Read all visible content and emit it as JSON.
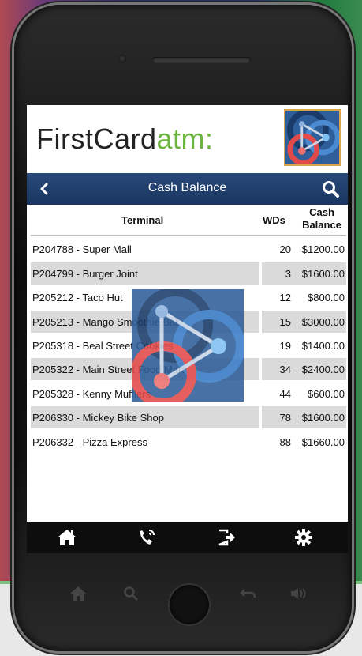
{
  "app": {
    "brand_main": "FirstCard",
    "brand_accent": "atm:",
    "accent_color": "#6db33f",
    "nav_color": "#1f3e6c"
  },
  "navbar": {
    "title": "Cash Balance",
    "back_icon": "chevron-left-icon",
    "search_icon": "search-icon"
  },
  "table": {
    "headers": {
      "terminal": "Terminal",
      "wds": "WDs",
      "balance_line1": "Cash",
      "balance_line2": "Balance"
    },
    "rows": [
      {
        "terminal": "P204788 - Super Mall",
        "wds": "20",
        "balance": "$1200.00"
      },
      {
        "terminal": "P204799 - Burger Joint",
        "wds": "3",
        "balance": "$1600.00"
      },
      {
        "terminal": "P205212 - Taco Hut",
        "wds": "12",
        "balance": "$800.00"
      },
      {
        "terminal": "P205213 - Mango Smoothie Bar",
        "wds": "15",
        "balance": "$3000.00"
      },
      {
        "terminal": "P205318 - Beal Street Cookies",
        "wds": "19",
        "balance": "$1400.00"
      },
      {
        "terminal": "P205322 - Main Street Food Mart",
        "wds": "34",
        "balance": "$2400.00"
      },
      {
        "terminal": "P205328 - Kenny Mufflers",
        "wds": "44",
        "balance": "$600.00"
      },
      {
        "terminal": "P206330 - Mickey Bike Shop",
        "wds": "78",
        "balance": "$1600.00"
      },
      {
        "terminal": "P206332 - Pizza Express",
        "wds": "88",
        "balance": "$1660.00"
      }
    ]
  },
  "tabbar": {
    "icons": [
      "home-icon",
      "phone-icon",
      "logout-icon",
      "settings-icon"
    ]
  },
  "hardware_buttons": [
    "home-icon",
    "search-icon",
    "home-button",
    "back-icon",
    "volume-icon"
  ]
}
